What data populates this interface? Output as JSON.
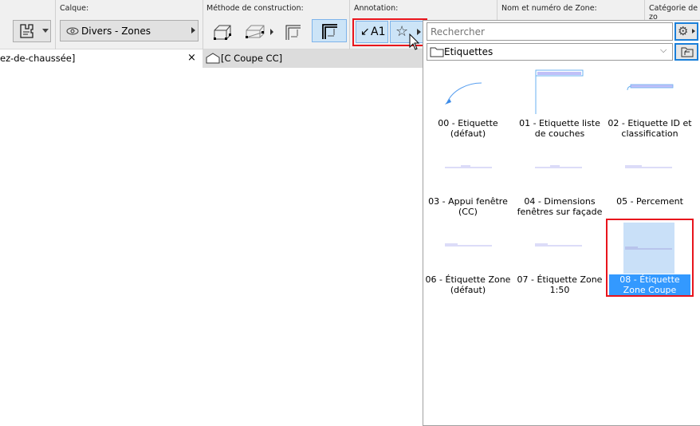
{
  "toolbar": {
    "layer_label": "Calque:",
    "layer_value": "Divers - Zones",
    "construction_label": "Méthode de construction:",
    "annotation_label": "Annotation:",
    "zone_name_label": "Nom et numéro de Zone:",
    "zone_category_label": "Catégorie de zo"
  },
  "tabs": [
    {
      "label": "ez-de-chaussée]",
      "close": "×"
    },
    {
      "label": "[C Coupe CC]"
    }
  ],
  "popup": {
    "search_placeholder": "Rechercher",
    "folder": "Etiquettes",
    "items": [
      {
        "label": "00 - Etiquette (défaut)"
      },
      {
        "label": "01 - Etiquette liste de couches"
      },
      {
        "label": "02 - Etiquette ID et classification"
      },
      {
        "label": "03 - Appui fenêtre (CC)"
      },
      {
        "label": "04 - Dimensions fenêtres sur façade"
      },
      {
        "label": "05 - Percement"
      },
      {
        "label": "06 - Étiquette Zone (défaut)"
      },
      {
        "label": "07 - Étiquette Zone 1:50"
      },
      {
        "label": "08 - Étiquette Zone Coupe",
        "selected": true
      }
    ]
  },
  "annotation_button_text": "A1",
  "colors": {
    "accent": "#3399ff",
    "highlight": "#e8141c",
    "selected_bg": "#cce4f7"
  }
}
